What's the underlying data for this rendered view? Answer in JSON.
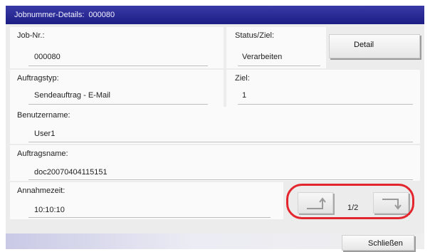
{
  "dialog": {
    "title": "Jobnummer-Details:",
    "job_number_display": "000080"
  },
  "fields": {
    "job_nr": {
      "label": "Job-Nr.:",
      "value": "000080"
    },
    "status": {
      "label": "Status/Ziel:",
      "value": "Verarbeiten"
    },
    "auftragstyp": {
      "label": "Auftragstyp:",
      "value": "Sendeauftrag - E-Mail"
    },
    "ziel": {
      "label": "Ziel:",
      "value": "1"
    },
    "benutzername": {
      "label": "Benutzername:",
      "value": "User1"
    },
    "auftragsname": {
      "label": "Auftragsname:",
      "value": "doc20070404115151"
    },
    "annahmezeit": {
      "label": "Annahmezeit:",
      "value": "10:10:10"
    }
  },
  "buttons": {
    "detail": "Detail",
    "close": "Schließen"
  },
  "pagination": {
    "current": "1/2"
  },
  "icons": {
    "prev": "page-up-arrow-icon",
    "next": "page-down-arrow-icon"
  },
  "colors": {
    "titlebar": "#1d1d85",
    "highlight": "#e3262d"
  }
}
